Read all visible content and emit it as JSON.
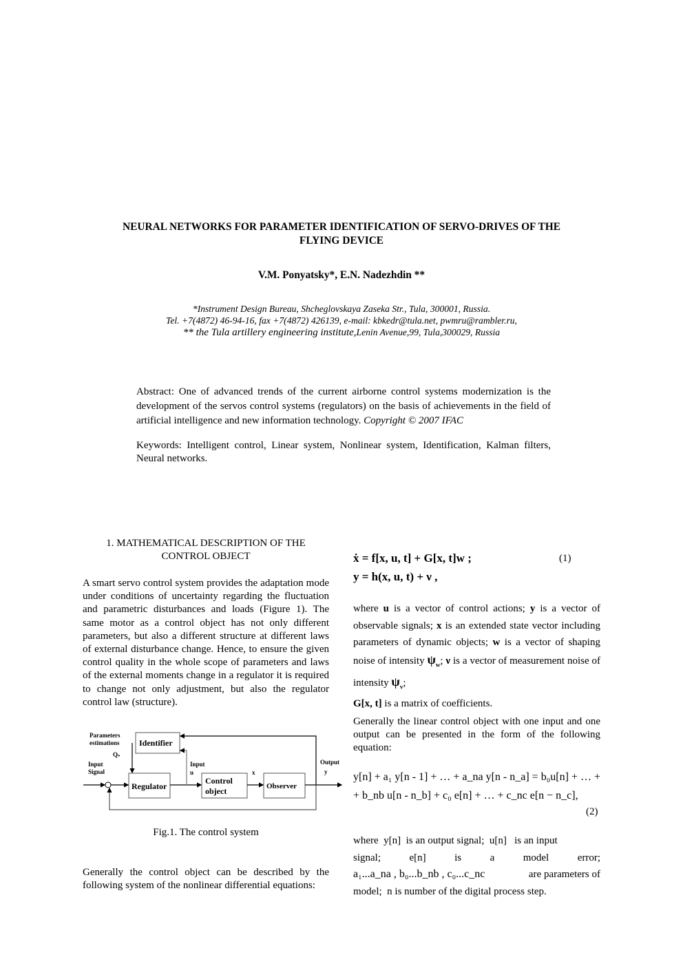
{
  "paper": {
    "title_line1": "NEURAL NETWORKS FOR PARAMETER IDENTIFICATION OF SERVO-DRIVES OF THE",
    "title_line2": "FLYING DEVICE",
    "authors": "V.M. Ponyatsky*, E.N. Nadezhdin **",
    "affiliations": [
      "*Instrument Design Bureau, Shcheglovskaya Zaseka Str., Tula, 300001, Russia.",
      "Tel. +7(4872) 46-94-16, fax  +7(4872) 426139, e-mail: kbkedr@tula.net, pwmru@rambler.ru,",
      "** the Tula artillery engineering institute,",
      "Lenin Avenue,99, Tula,300029, Russia"
    ],
    "abstract": {
      "text": "Abstract: One of advanced trends of the current airborne control systems modernization is the development of the servos control systems (regulators) on the basis of achievements in the field of artificial intelligence and new information technology.",
      "copyright": " Copyright © 2007 IFAC"
    },
    "keywords": "Keywords: Intelligent control, Linear system, Nonlinear system, Identification, Kalman filters, Neural networks."
  },
  "section1": {
    "heading_line1": "1. MATHEMATICAL DESCRIPTION OF THE",
    "heading_line2": "CONTROL OBJECT",
    "para1": "A smart servo control system provides the adaptation mode under conditions of uncertainty regarding the fluctuation and parametric disturbances and loads (Figure 1). The same motor as a control object has not only different parameters, but also a different structure at different laws of external disturbance change. Hence, to ensure the given control quality in the whole scope of parameters and laws of the external moments change in a regulator it is required to change not only adjustment, but also the regulator control law (structure).",
    "figure": {
      "caption": "Fig.1. The control system",
      "labels": {
        "params_line1": "Parameters",
        "params_line2": "estimations",
        "q": "Q",
        "q_sub": "*",
        "input_signal_line1": "Input",
        "input_signal_line2": "Signal",
        "input_u_line1": "Input",
        "input_u_line2": "u",
        "x": "x",
        "output_line1": "Output",
        "output_line2": "y"
      },
      "blocks": {
        "identifier": "Identifier",
        "regulator": "Regulator",
        "control_object_line1": "Control",
        "control_object_line2": "object",
        "observer": "Observer"
      }
    },
    "para2": "Generally the control object can be described by the following system of the nonlinear differential equations:",
    "eq1": {
      "line1": "ẋ = f[x, u, t] + G[x, t]w ;",
      "line2": "y = h(x, u, t) + ν ,",
      "number": "(1)"
    },
    "para3": {
      "t1": "where ",
      "u": "u",
      "t2": " is a vector of control actions; ",
      "y": "y",
      "t3": " is a vector of observable signals; ",
      "x": "x",
      "t4": " is an extended state vector including parameters of dynamic objects; ",
      "w": "w",
      "t5": " is a vector of shaping noise of intensity ",
      "psi": "ψ",
      "psi_w_sub": "w",
      "t6": "; ",
      "nu": "ν",
      "t7": " is a vector of measurement noise of intensity ",
      "psi_v_sub": "v",
      "t8": ";",
      "G": "G[x, t]",
      "t9": " is a matrix of coefficients."
    },
    "para4": "Generally the linear control object with one input and one output can be presented in the form of the following equation:",
    "eq2": {
      "line1": "y[n] + a₁ y[n - 1] + … + a_na y[n - n_a] = b₀u[n] + … +",
      "line2": "+ b_nb u[n - n_b] + c₀ e[n] + … + c_nc e[n − n_c],",
      "number": "(2)"
    },
    "para5": {
      "line1": "where  y[n]  is an output signal;  u[n]   is an input",
      "line2_words": [
        "signal;",
        "e[n]",
        "is",
        "a",
        "model",
        "error;"
      ],
      "line3_params": "a₁...a_na , b₀...b_nb , c₀...c_nc",
      "line3_tail": "are parameters of",
      "line4": "model;  n is number of the digital process step."
    }
  }
}
